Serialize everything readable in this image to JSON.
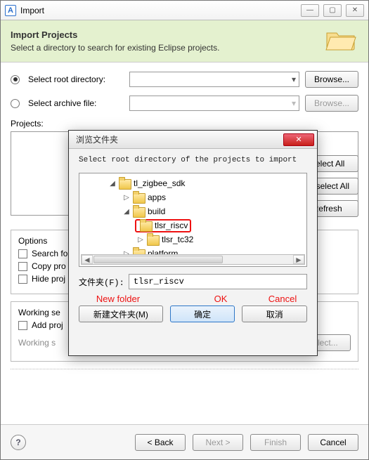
{
  "window": {
    "title": "Import",
    "app_icon_letter": "A"
  },
  "banner": {
    "heading": "Import Projects",
    "subheading": "Select a directory to search for existing Eclipse projects."
  },
  "source": {
    "root_label": "Select root directory:",
    "archive_label": "Select archive file:",
    "browse_label": "Browse...",
    "field_dropdown_glyph": "▾"
  },
  "projects": {
    "label": "Projects:",
    "select_all": "Select All",
    "deselect_all": "Deselect All",
    "refresh": "Refresh"
  },
  "options": {
    "legend": "Options",
    "search_nested": "Search fo",
    "copy_projects": "Copy pro",
    "hide_projects": "Hide proj"
  },
  "working_sets": {
    "legend": "Working se",
    "add_to": "Add proj",
    "label_faded": "Working s",
    "select_btn": "elect..."
  },
  "bottom": {
    "back": "< Back",
    "next": "Next >",
    "finish": "Finish",
    "cancel": "Cancel",
    "help_glyph": "?"
  },
  "browse": {
    "title": "浏览文件夹",
    "instruction": "Select root directory of the projects to import",
    "tree": {
      "n0": "tl_zigbee_sdk",
      "n1": "apps",
      "n2": "build",
      "n3": "tlsr_riscv",
      "n4": "tlsr_tc32",
      "n5": "platform"
    },
    "twists": {
      "open": "◢",
      "closed": "▷"
    },
    "path_label": "文件夹(F):",
    "path_value": "tlsr_riscv",
    "annot": {
      "new_folder": "New folder",
      "ok": "OK",
      "cancel": "Cancel"
    },
    "buttons": {
      "new_folder": "新建文件夹(M)",
      "ok": "确定",
      "cancel": "取消"
    },
    "close_glyph": "✕",
    "scroll": {
      "left": "◄",
      "right": "►"
    }
  }
}
